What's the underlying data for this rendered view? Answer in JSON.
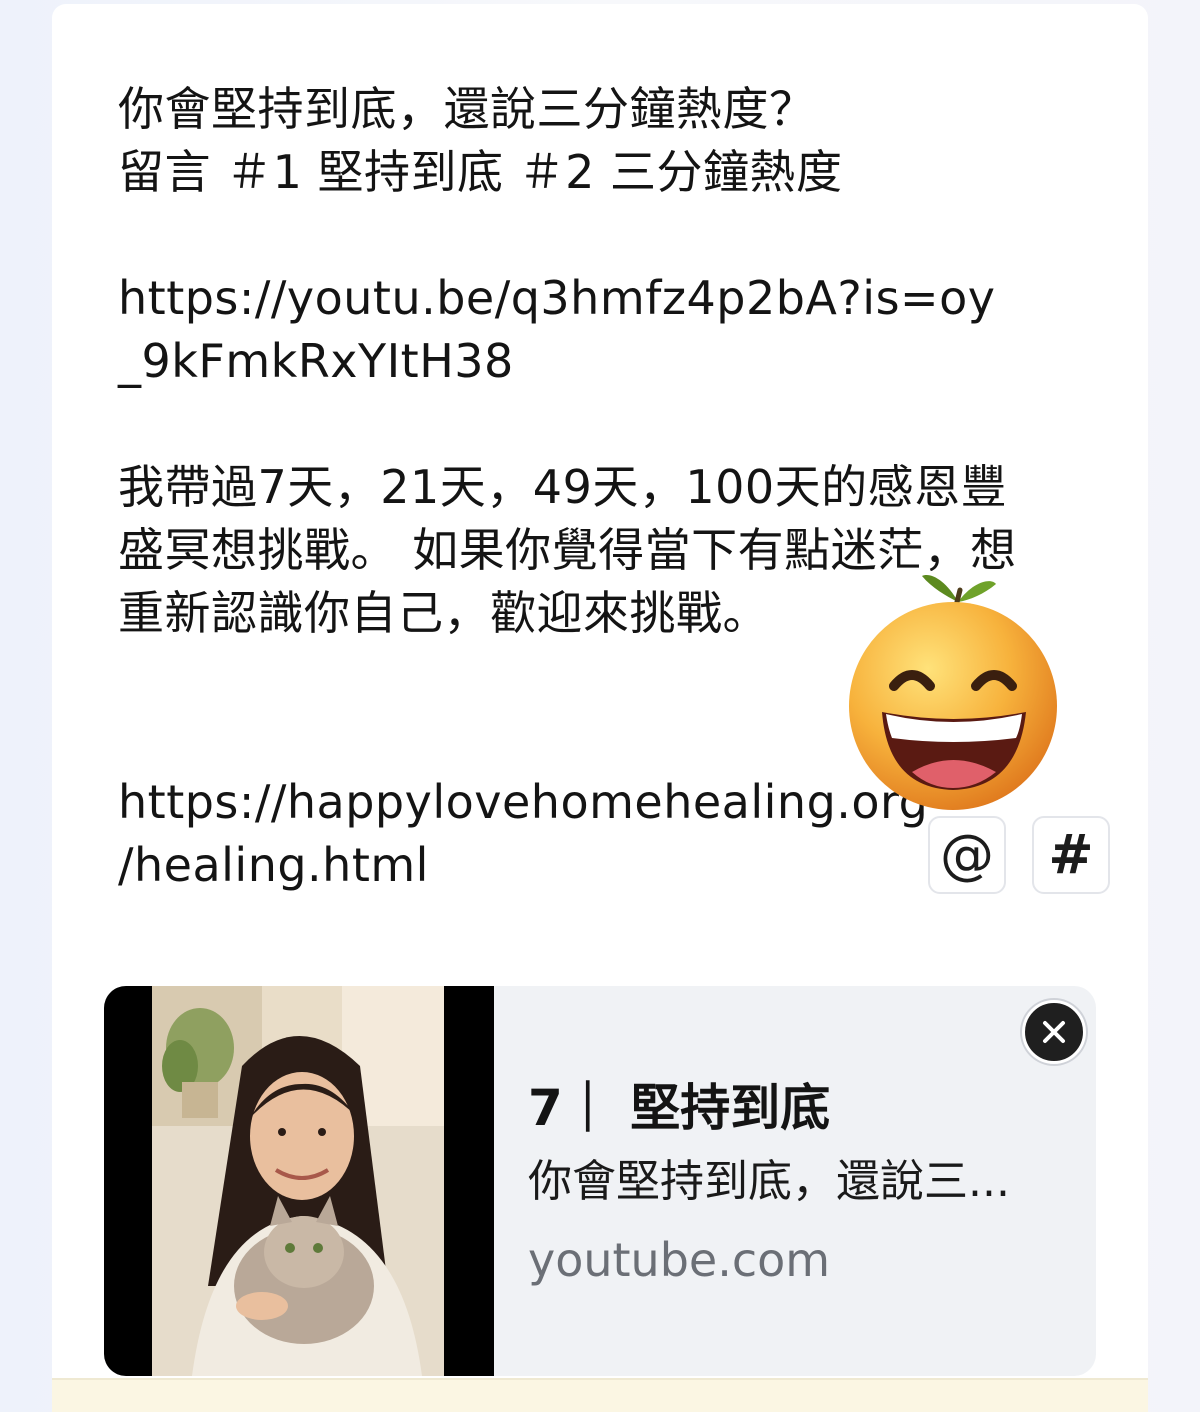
{
  "post": {
    "lines_1": [
      "你會堅持到底，還說三分鐘熱度？",
      "留言 ＃1 堅持到底 ＃2 三分鐘熱度"
    ],
    "link_1": [
      "https://youtu.be/q3hmfz4p2bA?is=oy",
      "_9kFmkRxYItH38"
    ],
    "lines_2": [
      "我帶過7天，21天，49天，100天的感恩豐",
      "盛冥想挑戰。 如果你覺得當下有點迷茫，想",
      "重新認識你自己，歡迎來挑戰。"
    ],
    "link_2": [
      "https://happylovehomehealing.org",
      "/healing.html"
    ]
  },
  "toolbar": {
    "mention_label": "@",
    "hashtag_label": "#"
  },
  "link_preview": {
    "title": "7｜ 堅持到底",
    "description": "你會堅持到底，還說三...",
    "domain": "youtube.com"
  },
  "icons": {
    "emoji": "grinning-orange-emoji-icon",
    "close": "close-icon"
  },
  "colors": {
    "text": "#141414",
    "domain_text": "#6b6f76",
    "preview_bg": "#f0f2f5",
    "emoji_orange": "#f4a23a"
  }
}
